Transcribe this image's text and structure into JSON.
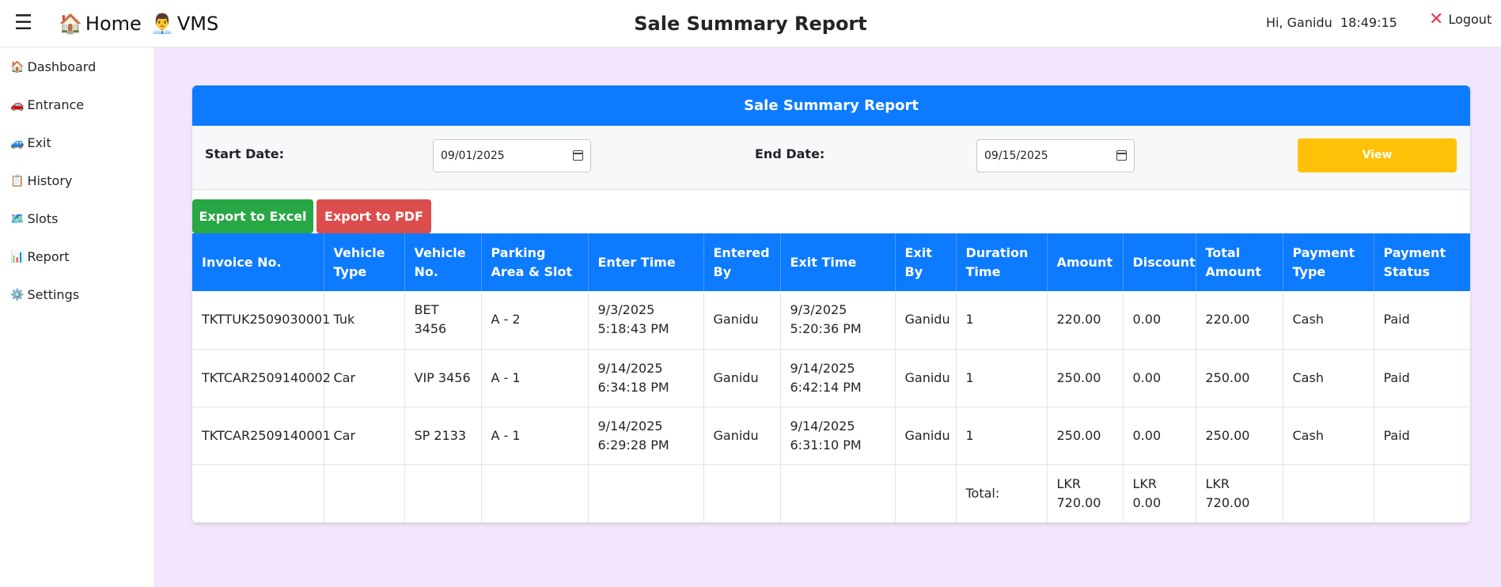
{
  "topbar": {
    "menu_icon": "☰",
    "home_emoji": "🏠",
    "home_label": "Home",
    "vms_emoji": "👨‍💼",
    "vms_label": "VMS",
    "title": "Sale Summary Report",
    "greeting": "Hi, Ganidu",
    "time": "18:49:15",
    "logout_icon": "✕",
    "logout_label": "Logout"
  },
  "sidebar": {
    "items": [
      {
        "icon": "🏠",
        "label": "Dashboard"
      },
      {
        "icon": "🚗",
        "label": "Entrance"
      },
      {
        "icon": "🚙",
        "label": "Exit"
      },
      {
        "icon": "📋",
        "label": "History"
      },
      {
        "icon": "🗺️",
        "label": "Slots"
      },
      {
        "icon": "📊",
        "label": "Report"
      },
      {
        "icon": "⚙️",
        "label": "Settings"
      }
    ]
  },
  "report": {
    "header": "Sale Summary Report",
    "start_label": "Start Date:",
    "start_value": "09/01/2025",
    "end_label": "End Date:",
    "end_value": "09/15/2025",
    "view_label": "View",
    "export_excel": "Export to Excel",
    "export_pdf": "Export to PDF"
  },
  "table": {
    "columns": [
      "Invoice No.",
      "Vehicle Type",
      "Vehicle No.",
      "Parking Area & Slot",
      "Enter Time",
      "Entered By",
      "Exit Time",
      "Exit By",
      "Duration Time",
      "Amount",
      "Discount",
      "Total Amount",
      "Payment Type",
      "Payment Status"
    ],
    "rows": [
      [
        "TKTTUK2509030001",
        "Tuk",
        "BET 3456",
        "A - 2",
        "9/3/2025 5:18:43 PM",
        "Ganidu",
        "9/3/2025 5:20:36 PM",
        "Ganidu",
        "1",
        "220.00",
        "0.00",
        "220.00",
        "Cash",
        "Paid"
      ],
      [
        "TKTCAR2509140002",
        "Car",
        "VIP 3456",
        "A - 1",
        "9/14/2025 6:34:18 PM",
        "Ganidu",
        "9/14/2025 6:42:14 PM",
        "Ganidu",
        "1",
        "250.00",
        "0.00",
        "250.00",
        "Cash",
        "Paid"
      ],
      [
        "TKTCAR2509140001",
        "Car",
        "SP 2133",
        "A - 1",
        "9/14/2025 6:29:28 PM",
        "Ganidu",
        "9/14/2025 6:31:10 PM",
        "Ganidu",
        "1",
        "250.00",
        "0.00",
        "250.00",
        "Cash",
        "Paid"
      ]
    ],
    "total": {
      "label": "Total:",
      "amount": "LKR 720.00",
      "discount": "LKR 0.00",
      "total_amount": "LKR 720.00"
    }
  },
  "colors": {
    "accent": "#0d7bff",
    "background": "#f3e5fb",
    "view_button": "#ffc107",
    "excel_button": "#28a745",
    "pdf_button": "#dc4d4d"
  }
}
